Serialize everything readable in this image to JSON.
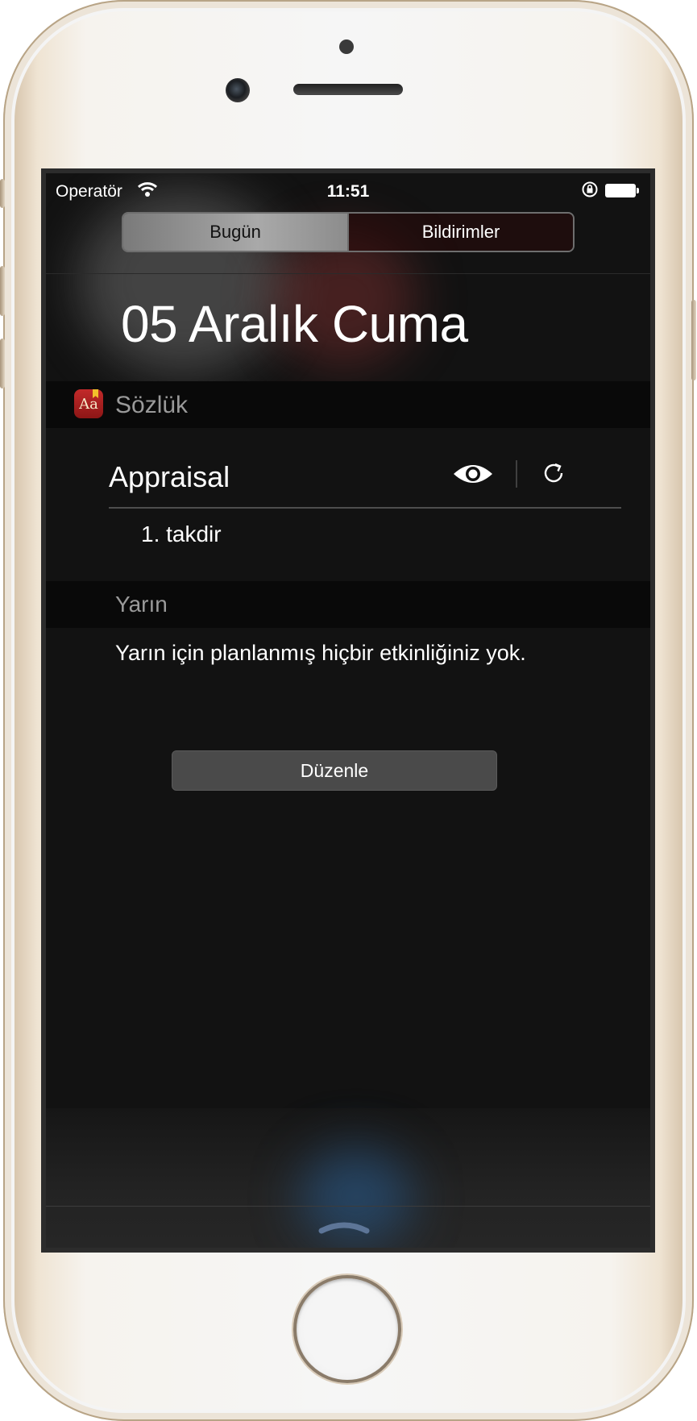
{
  "status_bar": {
    "carrier": "Operatör",
    "time": "11:51",
    "battery_level": 1.0
  },
  "segments": {
    "today": "Bugün",
    "notifications": "Bildirimler",
    "selected": "today"
  },
  "date_heading": "05 Aralık Cuma",
  "dictionary_widget": {
    "icon_text": "Aa",
    "title": "Sözlük",
    "word": "Appraisal",
    "definition": "1. takdir",
    "icons": [
      "eye-icon",
      "refresh-icon"
    ]
  },
  "tomorrow": {
    "title": "Yarın",
    "message": "Yarın için planlanmış hiçbir etkinliğiniz yok."
  },
  "edit_button": "Düzenle",
  "colors": {
    "screen_bg": "#121212",
    "section_header_bg": "#090909",
    "icon_red": "#b51f1f",
    "frame_gold": "#d9c7ae"
  }
}
